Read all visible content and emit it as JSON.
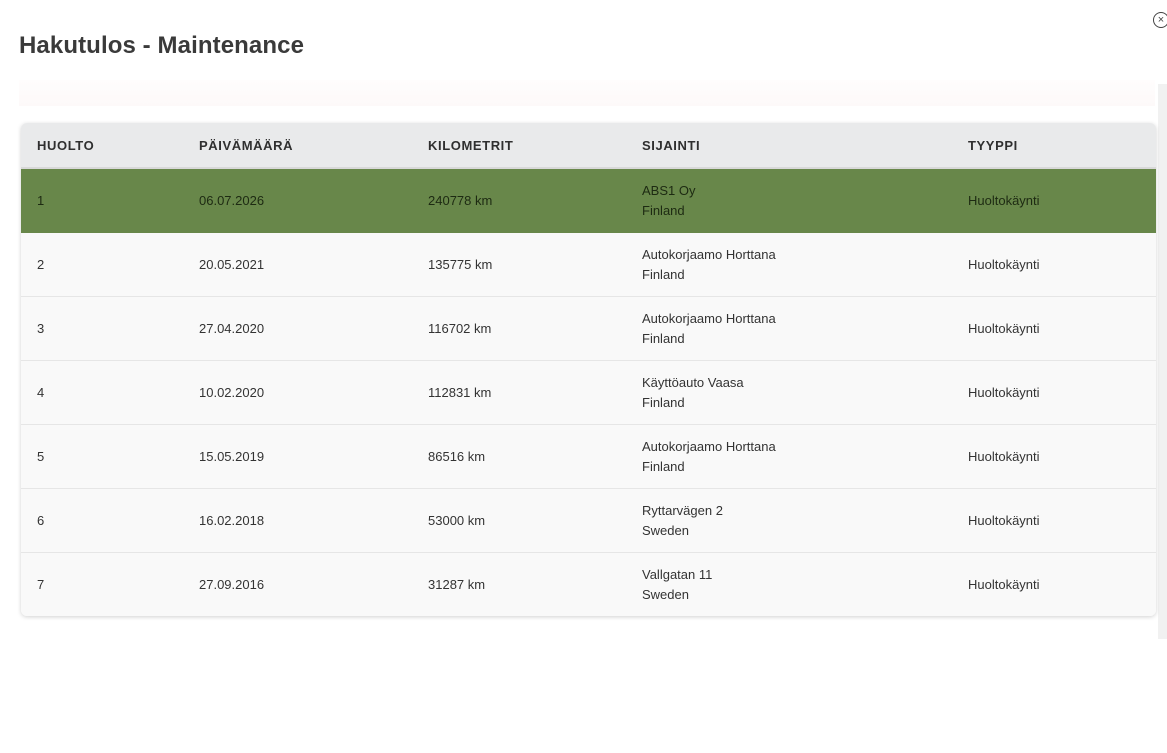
{
  "dialog": {
    "title": "Hakutulos - Maintenance",
    "close_symbol": "×"
  },
  "table": {
    "headers": [
      "HUOLTO",
      "PÄIVÄMÄÄRÄ",
      "KILOMETRIT",
      "SIJAINTI",
      "TYYPPI"
    ],
    "selected_row_color": "#68874a",
    "rows": [
      {
        "huolto": "1",
        "date": "06.07.2026",
        "km": "240778 km",
        "location_name": "ABS1 Oy",
        "location_country": "Finland",
        "type": "Huoltokäynti",
        "selected": true
      },
      {
        "huolto": "2",
        "date": "20.05.2021",
        "km": "135775 km",
        "location_name": "Autokorjaamo Horttana",
        "location_country": "Finland",
        "type": "Huoltokäynti",
        "selected": false
      },
      {
        "huolto": "3",
        "date": "27.04.2020",
        "km": "116702 km",
        "location_name": "Autokorjaamo Horttana",
        "location_country": "Finland",
        "type": "Huoltokäynti",
        "selected": false
      },
      {
        "huolto": "4",
        "date": "10.02.2020",
        "km": "112831 km",
        "location_name": "Käyttöauto Vaasa",
        "location_country": "Finland",
        "type": "Huoltokäynti",
        "selected": false
      },
      {
        "huolto": "5",
        "date": "15.05.2019",
        "km": "86516 km",
        "location_name": "Autokorjaamo Horttana",
        "location_country": "Finland",
        "type": "Huoltokäynti",
        "selected": false
      },
      {
        "huolto": "6",
        "date": "16.02.2018",
        "km": "53000 km",
        "location_name": "Ryttarvägen 2",
        "location_country": "Sweden",
        "type": "Huoltokäynti",
        "selected": false
      },
      {
        "huolto": "7",
        "date": "27.09.2016",
        "km": "31287 km",
        "location_name": "Vallgatan 11",
        "location_country": "Sweden",
        "type": "Huoltokäynti",
        "selected": false
      }
    ]
  }
}
